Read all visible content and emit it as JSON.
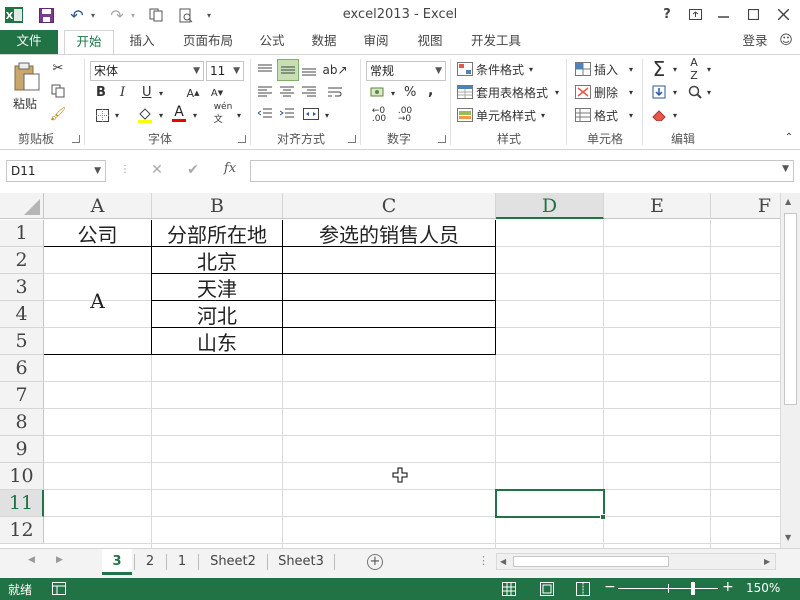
{
  "window": {
    "title": "excel2013 - Excel",
    "help_label": "?",
    "login_label": "登录"
  },
  "tabs": [
    {
      "label": "文件"
    },
    {
      "label": "开始"
    },
    {
      "label": "插入"
    },
    {
      "label": "页面布局"
    },
    {
      "label": "公式"
    },
    {
      "label": "数据"
    },
    {
      "label": "审阅"
    },
    {
      "label": "视图"
    },
    {
      "label": "开发工具"
    }
  ],
  "ribbon": {
    "clipboard": {
      "paste_label": "粘贴",
      "group_label": "剪贴板"
    },
    "font": {
      "font_name": "宋体",
      "font_size": "11",
      "group_label": "字体",
      "bold": "B",
      "italic": "I",
      "underline": "U",
      "font_color_glyph": "A"
    },
    "alignment": {
      "group_label": "对齐方式"
    },
    "number": {
      "format": "常规",
      "group_label": "数字",
      "percent": "%"
    },
    "styles": {
      "conditional": "条件格式",
      "table_format": "套用表格格式",
      "cell_styles": "单元格样式",
      "group_label": "样式"
    },
    "cells": {
      "insert": "插入",
      "delete": "删除",
      "format": "格式",
      "group_label": "单元格"
    },
    "editing": {
      "group_label": "编辑"
    }
  },
  "formula_bar": {
    "name_box": "D11",
    "cancel": "✕",
    "enter": "✔",
    "fx": "fx",
    "formula": ""
  },
  "columns": [
    {
      "label": "A"
    },
    {
      "label": "B"
    },
    {
      "label": "C"
    },
    {
      "label": "D"
    },
    {
      "label": "E"
    },
    {
      "label": "F"
    }
  ],
  "rows": [
    "1",
    "2",
    "3",
    "4",
    "5",
    "6",
    "7",
    "8",
    "9",
    "10",
    "11",
    "12"
  ],
  "cells": {
    "A1": "公司",
    "B1": "分部所在地",
    "C1": "参选的销售人员",
    "A2": "A",
    "B2": "北京",
    "B3": "天津",
    "B4": "河北",
    "B5": "山东"
  },
  "selected_cell": "D11",
  "sheets": [
    {
      "label": "3",
      "active": true
    },
    {
      "label": "2",
      "active": false
    },
    {
      "label": "1",
      "active": false
    },
    {
      "label": "Sheet2",
      "active": false
    },
    {
      "label": "Sheet3",
      "active": false
    }
  ],
  "status": {
    "ready": "就绪",
    "zoom": "150%",
    "zoom_fraction": 0.75
  },
  "colors": {
    "accent": "#217346",
    "header_bg": "#f3f3f3",
    "gridline": "#dadada"
  }
}
